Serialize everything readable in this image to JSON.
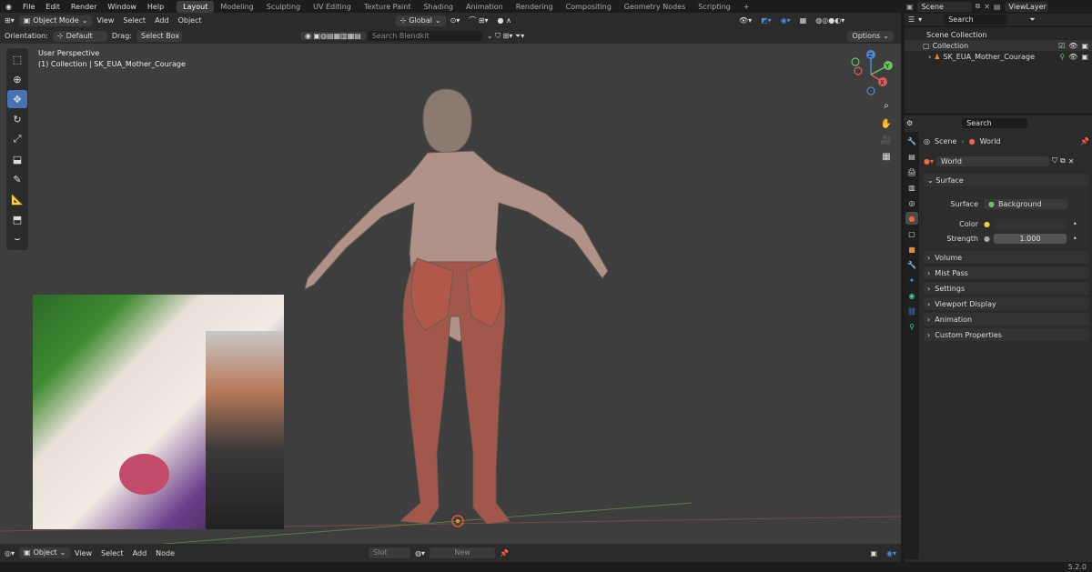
{
  "topbar": {
    "menus": [
      "File",
      "Edit",
      "Render",
      "Window",
      "Help"
    ],
    "workspaces": [
      "Layout",
      "Modeling",
      "Sculpting",
      "UV Editing",
      "Texture Paint",
      "Shading",
      "Animation",
      "Rendering",
      "Compositing",
      "Geometry Nodes",
      "Scripting"
    ],
    "active_workspace": "Layout",
    "scene": "Scene",
    "view_layer": "ViewLayer",
    "search_placeholder": "Search"
  },
  "viewport_header": {
    "mode": "Object Mode",
    "menus": [
      "View",
      "Select",
      "Add",
      "Object"
    ],
    "transform": "Global"
  },
  "viewport_tool": {
    "orientation_label": "Orientation:",
    "orientation_value": "Default",
    "drag_label": "Drag:",
    "drag_value": "Select Box",
    "search_placeholder": "Search Blendkit",
    "options": "Options"
  },
  "overlay": {
    "perspective": "User Perspective",
    "collection": "(1) Collection | SK_EUA_Mother_Courage"
  },
  "gizmo": {
    "z": "Z",
    "y": "Y",
    "x": "X"
  },
  "bottom": {
    "editor": "Object",
    "menus": [
      "View",
      "Select",
      "Add",
      "Node"
    ],
    "slot": "Slot",
    "new": "New"
  },
  "outliner": {
    "root": "Scene Collection",
    "collection": "Collection",
    "object": "SK_EUA_Mother_Courage"
  },
  "properties": {
    "search_placeholder": "Search",
    "crumb_scene": "Scene",
    "crumb_world": "World",
    "world_name": "World",
    "surface_panel": "Surface",
    "surface_label": "Surface",
    "surface_value": "Background",
    "color_label": "Color",
    "strength_label": "Strength",
    "strength_value": "1.000",
    "panels": [
      "Volume",
      "Mist Pass",
      "Settings",
      "Viewport Display",
      "Animation",
      "Custom Properties"
    ]
  },
  "version": "5.2.0",
  "colors": {
    "accent": "#4772b3",
    "world_green": "#6bc263",
    "color_swatch": "#e6d53a"
  }
}
